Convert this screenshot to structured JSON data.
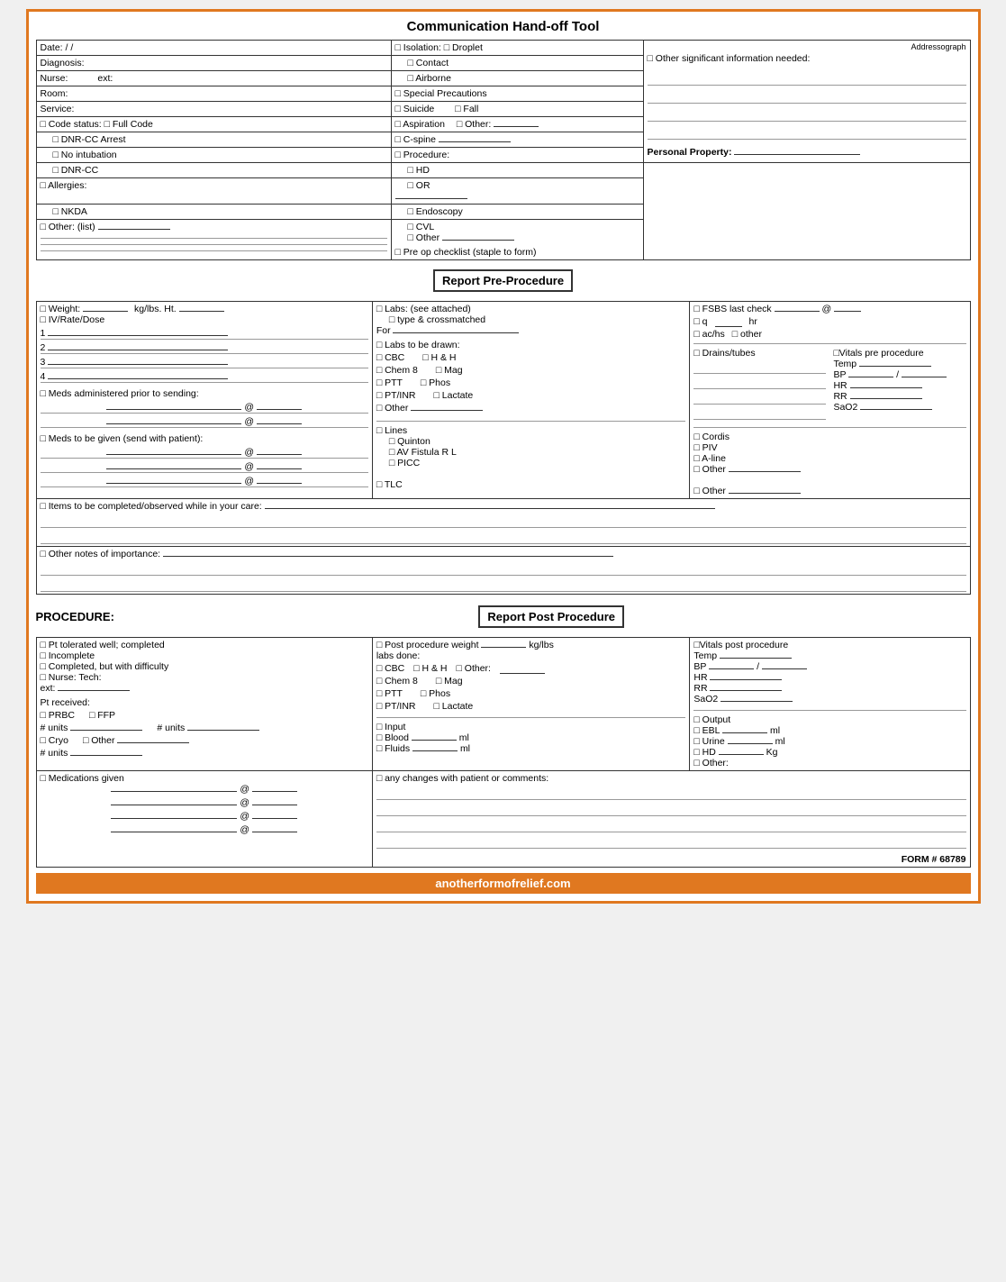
{
  "title": "Communication Hand-off Tool",
  "section1_header": "Report Pre-Procedure",
  "section2_header": "Report Post Procedure",
  "procedure_label": "PROCEDURE:",
  "form_number": "FORM # 68789",
  "footer_url": "anotherformofrelief.com",
  "top": {
    "date_label": "Date:",
    "date_value": "/ /",
    "diagnosis_label": "Diagnosis:",
    "nurse_label": "Nurse:",
    "ext_label": "ext:",
    "room_label": "Room:",
    "service_label": "Service:",
    "code_status_label": "□ Code status:",
    "full_code_label": "□ Full Code",
    "dnr_cc_arrest_label": "□ DNR-CC Arrest",
    "no_intubation_label": "□ No intubation",
    "dnr_cc_label": "□ DNR-CC",
    "allergies_label": "□ Allergies:",
    "nkda_label": "□ NKDA",
    "other_list_label": "□ Other: (list)",
    "isolation_label": "□ Isolation:",
    "droplet_label": "□ Droplet",
    "contact_label": "□ Contact",
    "airborne_label": "□ Airborne",
    "special_prec_label": "□ Special Precautions",
    "suicide_label": "□ Suicide",
    "fall_label": "□ Fall",
    "aspiration_label": "□ Aspiration",
    "other_prec_label": "□ Other:",
    "cspine_label": "□ C-spine",
    "procedure_label": "□ Procedure:",
    "hd_label": "□ HD",
    "or_label": "□ OR",
    "endoscopy_label": "□ Endoscopy",
    "cvl_label": "□ CVL",
    "other_proc_label": "□ Other",
    "pre_op_label": "□ Pre op checklist (staple to form)",
    "addressograph_label": "Addressograph",
    "other_sig_label": "□ Other significant information needed:",
    "personal_prop_label": "Personal Property:"
  },
  "pre_procedure": {
    "weight_label": "□ Weight:",
    "weight_units": "kg/lbs.  Ht.",
    "iv_rate_label": "□ IV/Rate/Dose",
    "lines_1": "1",
    "lines_2": "2",
    "lines_3": "3",
    "lines_4": "4",
    "meds_prior_label": "□ Meds administered prior to sending:",
    "meds_send_label": "□ Meds to be given (send with patient):",
    "items_label": "□ Items to be completed/observed while in your care:",
    "other_notes_label": "□ Other notes of importance:",
    "labs_label": "□ Labs: (see attached)",
    "type_cross_label": "□ type & crossmatched",
    "for_label": "For",
    "labs_drawn_label": "□ Labs to be drawn:",
    "cbc_label": "□ CBC",
    "hh_label": "□ H & H",
    "chem8_label": "□ Chem 8",
    "mag_label": "□ Mag",
    "ptt_label": "□ PTT",
    "phos_label": "□ Phos",
    "ptinr_label": "□ PT/INR",
    "lactate_label": "□ Lactate",
    "other_labs_label": "□ Other",
    "lines_section_label": "□ Lines",
    "quinton_label": "□ Quinton",
    "av_fistula_label": "□ AV Fistula  R   L",
    "picc_label": "□ PICC",
    "tlc_label": "□ TLC",
    "drains_label": "□ Drains/tubes",
    "cordis_label": "□ Cordis",
    "piv_label": "□ PIV",
    "aline_label": "□ A-line",
    "other_lines_label": "□ Other",
    "other_tlc_label": "□ Other",
    "fsbs_label": "□ FSBS last check",
    "at_label": "@",
    "q_label": "□ q",
    "hr_label": "hr",
    "achs_label": "□ ac/hs",
    "other_fsbs_label": "□ other",
    "vitals_pre_label": "□Vitals pre procedure",
    "temp_label": "Temp",
    "bp_label": "BP",
    "bp_slash": "/",
    "hr_vital_label": "HR",
    "rr_label": "RR",
    "sao2_label": "SaO2"
  },
  "post_procedure": {
    "pt_tolerated_label": "□ Pt tolerated well; completed",
    "incomplete_label": "□ Incomplete",
    "completed_diff_label": "□ Completed, but with difficulty",
    "nurse_tech_label": "□ Nurse: Tech:",
    "ext_label": "ext:",
    "pt_received_label": "Pt received:",
    "prbc_label": "□ PRBC",
    "ffp_label": "□ FFP",
    "units_prbc_label": "# units",
    "units_ffp_label": "# units",
    "cryo_label": "□ Cryo",
    "other_blood_label": "□ Other",
    "units_cryo_label": "# units",
    "post_weight_label": "□ Post procedure weight",
    "kg_lbs_label": "kg/lbs",
    "labs_done_label": "labs done:",
    "cbc_post_label": "□ CBC",
    "hh_post_label": "□ H & H",
    "other_post_label": "□ Other:",
    "chem8_post_label": "□ Chem 8",
    "mag_post_label": "□ Mag",
    "ptt_post_label": "□ PTT",
    "phos_post_label": "□ Phos",
    "ptinr_post_label": "□ PT/INR",
    "lactate_post_label": "□ Lactate",
    "input_label": "□ Input",
    "blood_label": "□ Blood",
    "ml_blood_label": "ml",
    "fluids_label": "□ Fluids",
    "ml_fluids_label": "ml",
    "vitals_post_label": "□Vitals post procedure",
    "temp_post_label": "Temp",
    "bp_post_label": "BP",
    "bp_slash_post": "/",
    "hr_post_label": "HR",
    "rr_post_label": "RR",
    "sao2_post_label": "SaO2",
    "output_label": "□ Output",
    "ebl_label": "□ EBL",
    "ml_ebl": "ml",
    "urine_label": "□ Urine",
    "ml_urine": "ml",
    "hd_post_label": "□ HD",
    "kg_hd": "Kg",
    "other_output_label": "□ Other:",
    "meds_given_label": "□ Medications given",
    "any_changes_label": "□ any changes with patient or comments:"
  }
}
